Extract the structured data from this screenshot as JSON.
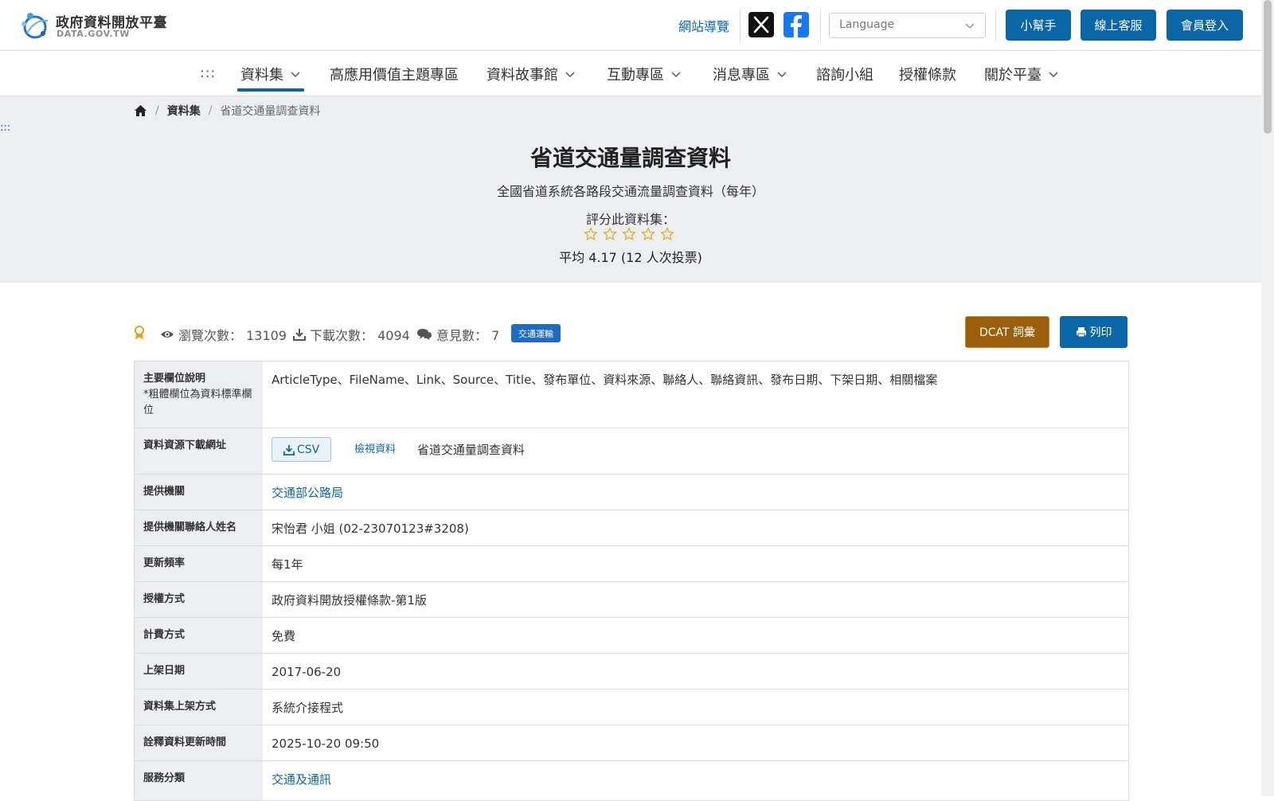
{
  "header": {
    "logo_title": "政府資料開放平臺",
    "logo_sub": "DATA.GOV.TW",
    "sitemap": "網站導覽",
    "language_placeholder": "Language",
    "buttons": {
      "help": "小幫手",
      "service": "線上客服",
      "login": "會員登入"
    }
  },
  "nav": {
    "accesskey": ":::",
    "items": [
      {
        "label": "資料集",
        "dropdown": true,
        "active": true
      },
      {
        "label": "高應用價值主題專區",
        "dropdown": false
      },
      {
        "label": "資料故事館",
        "dropdown": true
      },
      {
        "label": "互動專區",
        "dropdown": true
      },
      {
        "label": "消息專區",
        "dropdown": true
      },
      {
        "label": "諮詢小組",
        "dropdown": false
      },
      {
        "label": "授權條款",
        "dropdown": false
      },
      {
        "label": "關於平臺",
        "dropdown": true
      }
    ]
  },
  "breadcrumb": {
    "level1": "資料集",
    "current": "省道交通量調查資料",
    "sep": "/"
  },
  "hero": {
    "accesskey": ":::",
    "title": "省道交通量調查資料",
    "description": "全國省道系統各路段交通流量調查資料（每年）",
    "rate_label": "評分此資料集：",
    "rating_filled": 0,
    "rating_max": 5,
    "average": "平均 4.17 (12 人次投票)"
  },
  "stats": {
    "views": "瀏覽次數： 13109",
    "downloads": "下載次數： 4094",
    "comments": "意見數： 7",
    "tag": "交通運輸",
    "dcat_button": "DCAT 詞彙",
    "print_button": "列印"
  },
  "info": {
    "fields_label": "主要欄位說明",
    "fields_note": "*粗體欄位為資料標準欄位",
    "fields_value": "ArticleType、FileName、Link、Source、Title、發布單位、資料來源、聯絡人、聯絡資訊、發布日期、下架日期、相關檔案",
    "resource_label": "資料資源下載網址",
    "csv": "CSV",
    "view_data": "檢視資料",
    "resource_name": "省道交通量調查資料",
    "provider_label": "提供機關",
    "provider": "交通部公路局",
    "contact_label": "提供機關聯絡人姓名",
    "contact": "宋怡君 小姐 (02-23070123#3208)",
    "frequency_label": "更新頻率",
    "frequency": "每1年",
    "license_label": "授權方式",
    "license": "政府資料開放授權條款-第1版",
    "fee_label": "計費方式",
    "fee": "免費",
    "onshelf_label": "上架日期",
    "onshelf": "2017-06-20",
    "method_label": "資料集上架方式",
    "method": "系統介接程式",
    "meta_updated_label": "詮釋資料更新時間",
    "meta_updated": "2025-10-20 09:50",
    "service_label": "服務分類",
    "service": "交通及通訊"
  },
  "colors": {
    "brand_blue": "#0b66a8",
    "dcat_brown": "#9b5f0b",
    "hero_bg": "#eceef1",
    "star_outline": "#e0a800",
    "tag_blue": "#1f6bc0"
  }
}
